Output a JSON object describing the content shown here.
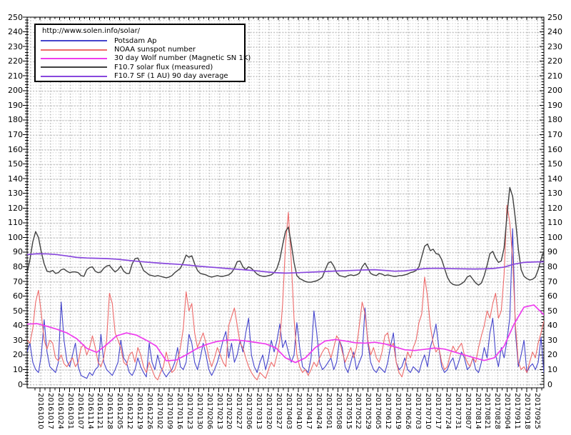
{
  "legend": {
    "url": "http://www.solen.info/solar/"
  },
  "chart_data": {
    "type": "line",
    "title": "",
    "xlabel": "",
    "ylabel": "",
    "grid": true,
    "legend_position": "top-left",
    "x_axis": {
      "start_date": "20161001",
      "end_date": "20170930",
      "tick_interval_days": 7,
      "tick_labels": [
        "20161010",
        "20161017",
        "20161024",
        "20161031",
        "20161107",
        "20161114",
        "20161121",
        "20161128",
        "20161205",
        "20161212",
        "20161219",
        "20161226",
        "20170102",
        "20170109",
        "20170116",
        "20170123",
        "20170130",
        "20170206",
        "20170213",
        "20170220",
        "20170227",
        "20170306",
        "20170313",
        "20170320",
        "20170327",
        "20170403",
        "20170410",
        "20170417",
        "20170424",
        "20170501",
        "20170508",
        "20170515",
        "20170522",
        "20170529",
        "20170605",
        "20170612",
        "20170619",
        "20170626",
        "20170703",
        "20170710",
        "20170717",
        "20170724",
        "20170731",
        "20170807",
        "20170814",
        "20170821",
        "20170828",
        "20170904",
        "20170911",
        "20170918",
        "20170925"
      ]
    },
    "y_axis": {
      "min": 0,
      "max": 250,
      "label_interval": 10,
      "minor_tick_interval": 2,
      "tick_labels": [
        250,
        240,
        230,
        220,
        210,
        200,
        190,
        180,
        170,
        160,
        150,
        140,
        130,
        120,
        110,
        100,
        90,
        80,
        70,
        60,
        50,
        40,
        30,
        20,
        10,
        0
      ]
    },
    "series": [
      {
        "id": "potsdam-ap",
        "name": "Potsdam Ap",
        "color": "#4444cc",
        "line_width": 1.1,
        "start_date": "20161001",
        "step_days": 2,
        "values": [
          22,
          28,
          15,
          10,
          8,
          20,
          44,
          22,
          12,
          10,
          8,
          15,
          56,
          30,
          16,
          12,
          20,
          28,
          12,
          6,
          5,
          4,
          8,
          6,
          10,
          12,
          34,
          15,
          10,
          8,
          6,
          10,
          15,
          30,
          18,
          15,
          8,
          6,
          10,
          18,
          12,
          8,
          5,
          28,
          15,
          10,
          20,
          12,
          8,
          5,
          8,
          10,
          15,
          25,
          12,
          10,
          15,
          34,
          28,
          15,
          10,
          18,
          28,
          20,
          10,
          6,
          10,
          15,
          22,
          30,
          36,
          18,
          28,
          15,
          20,
          30,
          22,
          35,
          45,
          20,
          12,
          8,
          15,
          20,
          10,
          18,
          30,
          22,
          30,
          41,
          25,
          30,
          22,
          15,
          20,
          42,
          25,
          12,
          10,
          8,
          18,
          50,
          35,
          15,
          10,
          12,
          15,
          18,
          10,
          15,
          30,
          25,
          12,
          8,
          15,
          22,
          10,
          15,
          20,
          52,
          28,
          15,
          10,
          8,
          12,
          10,
          8,
          15,
          26,
          35,
          15,
          10,
          12,
          18,
          10,
          8,
          12,
          10,
          8,
          15,
          20,
          12,
          25,
          32,
          41,
          25,
          12,
          8,
          10,
          15,
          18,
          10,
          15,
          22,
          18,
          10,
          12,
          18,
          10,
          8,
          15,
          25,
          18,
          35,
          45,
          20,
          12,
          25,
          18,
          30,
          45,
          106,
          35,
          12,
          20,
          30,
          8,
          12,
          14,
          10,
          15,
          32,
          8
        ]
      },
      {
        "id": "noaa-sunspot",
        "name": "NOAA sunspot number",
        "color": "#ee6a6a",
        "line_width": 1.1,
        "start_date": "20161001",
        "step_days": 2,
        "values": [
          30,
          28,
          38,
          56,
          64,
          48,
          30,
          24,
          30,
          28,
          18,
          16,
          20,
          14,
          12,
          15,
          18,
          12,
          15,
          25,
          27,
          20,
          25,
          33,
          25,
          15,
          12,
          18,
          30,
          62,
          55,
          35,
          30,
          25,
          15,
          13,
          20,
          22,
          15,
          25,
          20,
          12,
          8,
          15,
          10,
          5,
          3,
          8,
          12,
          22,
          14,
          8,
          10,
          16,
          25,
          38,
          63,
          50,
          55,
          35,
          25,
          30,
          35,
          28,
          18,
          12,
          18,
          25,
          20,
          15,
          12,
          40,
          46,
          52,
          40,
          28,
          25,
          18,
          12,
          8,
          5,
          3,
          8,
          6,
          4,
          10,
          15,
          12,
          20,
          30,
          55,
          95,
          117,
          85,
          45,
          20,
          12,
          8,
          10,
          6,
          10,
          15,
          12,
          18,
          22,
          25,
          24,
          18,
          25,
          33,
          30,
          22,
          15,
          20,
          25,
          18,
          25,
          40,
          56,
          48,
          30,
          20,
          25,
          18,
          15,
          22,
          33,
          35,
          25,
          28,
          15,
          8,
          5,
          12,
          22,
          18,
          25,
          30,
          42,
          48,
          73,
          60,
          40,
          28,
          22,
          25,
          15,
          10,
          12,
          20,
          26,
          22,
          25,
          28,
          20,
          15,
          12,
          18,
          15,
          25,
          33,
          40,
          50,
          45,
          55,
          62,
          45,
          50,
          75,
          122,
          110,
          85,
          40,
          15,
          10,
          12,
          8,
          15,
          22,
          18,
          28,
          35,
          43
        ]
      },
      {
        "id": "wolf-30day",
        "name": "30 day Wolf number (Magnetic SN 1K)",
        "color": "#ee3cee",
        "line_width": 1.7,
        "start_date": "20161001",
        "step_days": 7,
        "values": [
          41,
          41.3,
          39.5,
          37.5,
          35,
          31,
          24.5,
          21.7,
          27,
          33,
          35,
          33.5,
          30,
          26,
          16,
          16.5,
          20,
          24,
          27,
          29,
          30,
          30.2,
          29.5,
          28.5,
          27.5,
          25,
          18,
          14.8,
          18,
          25,
          29.5,
          30.5,
          29.5,
          28.3,
          28,
          28.6,
          27.5,
          25.5,
          23.5,
          23,
          23.8,
          24.7,
          24,
          22,
          20,
          18,
          16.2,
          18,
          26,
          41,
          52.5,
          54,
          47.3
        ]
      },
      {
        "id": "f107-flux",
        "name": "F10.7 solar flux (measured)",
        "color": "#404040",
        "line_width": 1.4,
        "start_date": "20161001",
        "step_days": 2,
        "values": [
          76,
          85,
          97,
          104,
          100,
          90,
          82,
          77,
          76.5,
          77.5,
          75.5,
          76,
          78,
          78.5,
          77,
          76,
          76.5,
          76.5,
          76,
          74,
          73.5,
          78,
          79.5,
          80,
          77,
          76,
          76.5,
          79,
          80.5,
          81,
          78.5,
          76.5,
          78,
          80.5,
          77,
          75.5,
          75.5,
          82,
          85.5,
          86,
          82,
          77.5,
          76,
          74.5,
          74,
          73.5,
          74,
          73.5,
          73,
          72.5,
          73,
          74,
          76,
          77.5,
          79,
          83,
          88,
          86.5,
          87.5,
          82,
          77.5,
          75.5,
          75,
          74.5,
          73.5,
          73,
          73.5,
          74,
          73.5,
          73.5,
          74,
          74.5,
          76,
          79,
          83.5,
          84,
          80,
          78,
          80,
          79,
          77,
          75,
          74,
          73.5,
          73.5,
          74,
          74.5,
          76,
          79,
          85,
          95,
          104,
          107,
          96,
          83,
          74,
          72,
          71,
          70,
          69.5,
          69.5,
          70,
          70.5,
          71.5,
          73,
          78,
          82.5,
          83.5,
          80.5,
          76,
          74,
          73.5,
          73,
          74,
          74.5,
          74,
          74.5,
          75.5,
          80,
          82.5,
          79,
          75.5,
          74.5,
          74,
          75.5,
          75,
          74,
          74.5,
          74,
          73.5,
          73.5,
          74,
          74,
          74.5,
          75,
          76,
          76.5,
          77.5,
          80,
          87,
          94,
          95.5,
          91,
          92,
          89,
          88.5,
          85,
          79,
          73,
          69.5,
          68,
          67.5,
          67.5,
          68.5,
          70,
          73,
          74,
          71.5,
          69,
          67.5,
          69,
          74,
          81,
          89,
          90.5,
          86,
          83,
          84,
          93,
          115,
          134,
          128,
          112,
          92,
          78,
          73.5,
          72,
          71,
          71.5,
          73,
          78,
          85,
          91
        ]
      },
      {
        "id": "f107-90day-avg",
        "name": "F10.7 SF (1 AU) 90 day average",
        "color": "#8847dd",
        "line_width": 1.7,
        "start_date": "20161001",
        "step_days": 7,
        "values": [
          88.3,
          88.9,
          88.8,
          88.3,
          87.4,
          86.4,
          86,
          85.8,
          85.6,
          85.2,
          84.5,
          83.8,
          83.2,
          82.7,
          82.2,
          81.8,
          81.3,
          80.6,
          80,
          79.5,
          78.9,
          78.4,
          77.9,
          77.3,
          76.6,
          76,
          75.7,
          75.9,
          76.2,
          76.5,
          76.8,
          77.1,
          77.3,
          77.6,
          77.9,
          78,
          77.5,
          77,
          77.2,
          78,
          78.8,
          79,
          78.9,
          78.7,
          78.6,
          78.5,
          78.6,
          78.9,
          79.8,
          81.8,
          83,
          83.3,
          83.4
        ]
      }
    ]
  }
}
